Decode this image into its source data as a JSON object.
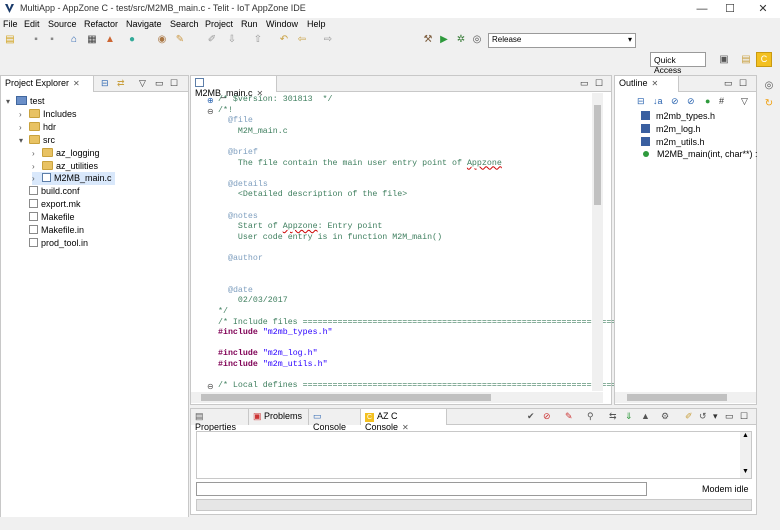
{
  "window": {
    "title": "MultiApp - AppZone C - test/src/M2MB_main.c - Telit - IoT AppZone IDE",
    "controls": [
      "—",
      "☐",
      "✕"
    ]
  },
  "menu": [
    "File",
    "Edit",
    "Source",
    "Refactor",
    "Navigate",
    "Search",
    "Project",
    "Run",
    "Window",
    "Help"
  ],
  "toolbar": {
    "build_config": "Release",
    "quick_access": "Quick Access"
  },
  "project_explorer": {
    "tab_label": "Project Explorer",
    "items": [
      {
        "label": "test",
        "icon": "project-icon",
        "level": 0,
        "twisty": "▾"
      },
      {
        "label": "Includes",
        "icon": "folder-icon",
        "level": 1,
        "twisty": "›"
      },
      {
        "label": "hdr",
        "icon": "folder-icon",
        "level": 1,
        "twisty": "›"
      },
      {
        "label": "src",
        "icon": "folder-icon",
        "level": 1,
        "twisty": "▾"
      },
      {
        "label": "az_logging",
        "icon": "folder-icon",
        "level": 2,
        "twisty": "›"
      },
      {
        "label": "az_utilities",
        "icon": "folder-icon",
        "level": 2,
        "twisty": "›"
      },
      {
        "label": "M2MB_main.c",
        "icon": "c-file-icon",
        "level": 2,
        "twisty": "›",
        "selected": true
      },
      {
        "label": "build.conf",
        "icon": "file-icon",
        "level": 1,
        "twisty": ""
      },
      {
        "label": "export.mk",
        "icon": "file-icon",
        "level": 1,
        "twisty": ""
      },
      {
        "label": "Makefile",
        "icon": "file-icon",
        "level": 1,
        "twisty": ""
      },
      {
        "label": "Makefile.in",
        "icon": "file-icon",
        "level": 1,
        "twisty": ""
      },
      {
        "label": "prod_tool.in",
        "icon": "file-icon",
        "level": 1,
        "twisty": ""
      }
    ]
  },
  "editor": {
    "tab_label": "M2MB_main.c",
    "lines": [
      "/* $version: 301813  */",
      "/*!",
      "  @file",
      "    M2M_main.c",
      "",
      "  @brief",
      "    The file contain the main user entry point of Appzone",
      "",
      "  @details",
      "    <Detailed description of the file>",
      "",
      "  @notes",
      "    Start of Appzone: Entry point",
      "    User code entry is in function M2M_main()",
      "",
      "  @author",
      "",
      "",
      "  @date",
      "    02/03/2017",
      "*/",
      "/* Include files ================================================================",
      "#include \"m2mb_types.h\"",
      "",
      "#include \"m2m_log.h\"",
      "#include \"m2m_utils.h\"",
      "",
      "/* Local defines ================================================================"
    ]
  },
  "outline": {
    "tab_label": "Outline",
    "items": [
      {
        "label": "m2mb_types.h",
        "icon": "include-icon"
      },
      {
        "label": "m2m_log.h",
        "icon": "include-icon"
      },
      {
        "label": "m2m_utils.h",
        "icon": "include-icon"
      },
      {
        "label": "M2MB_main(int, char**) :",
        "icon": "function-icon"
      }
    ]
  },
  "bottom": {
    "tabs": [
      "Properties",
      "Problems",
      "Console",
      "AZ C Console"
    ],
    "active_tab": "AZ C Console",
    "status": "Modem idle"
  }
}
